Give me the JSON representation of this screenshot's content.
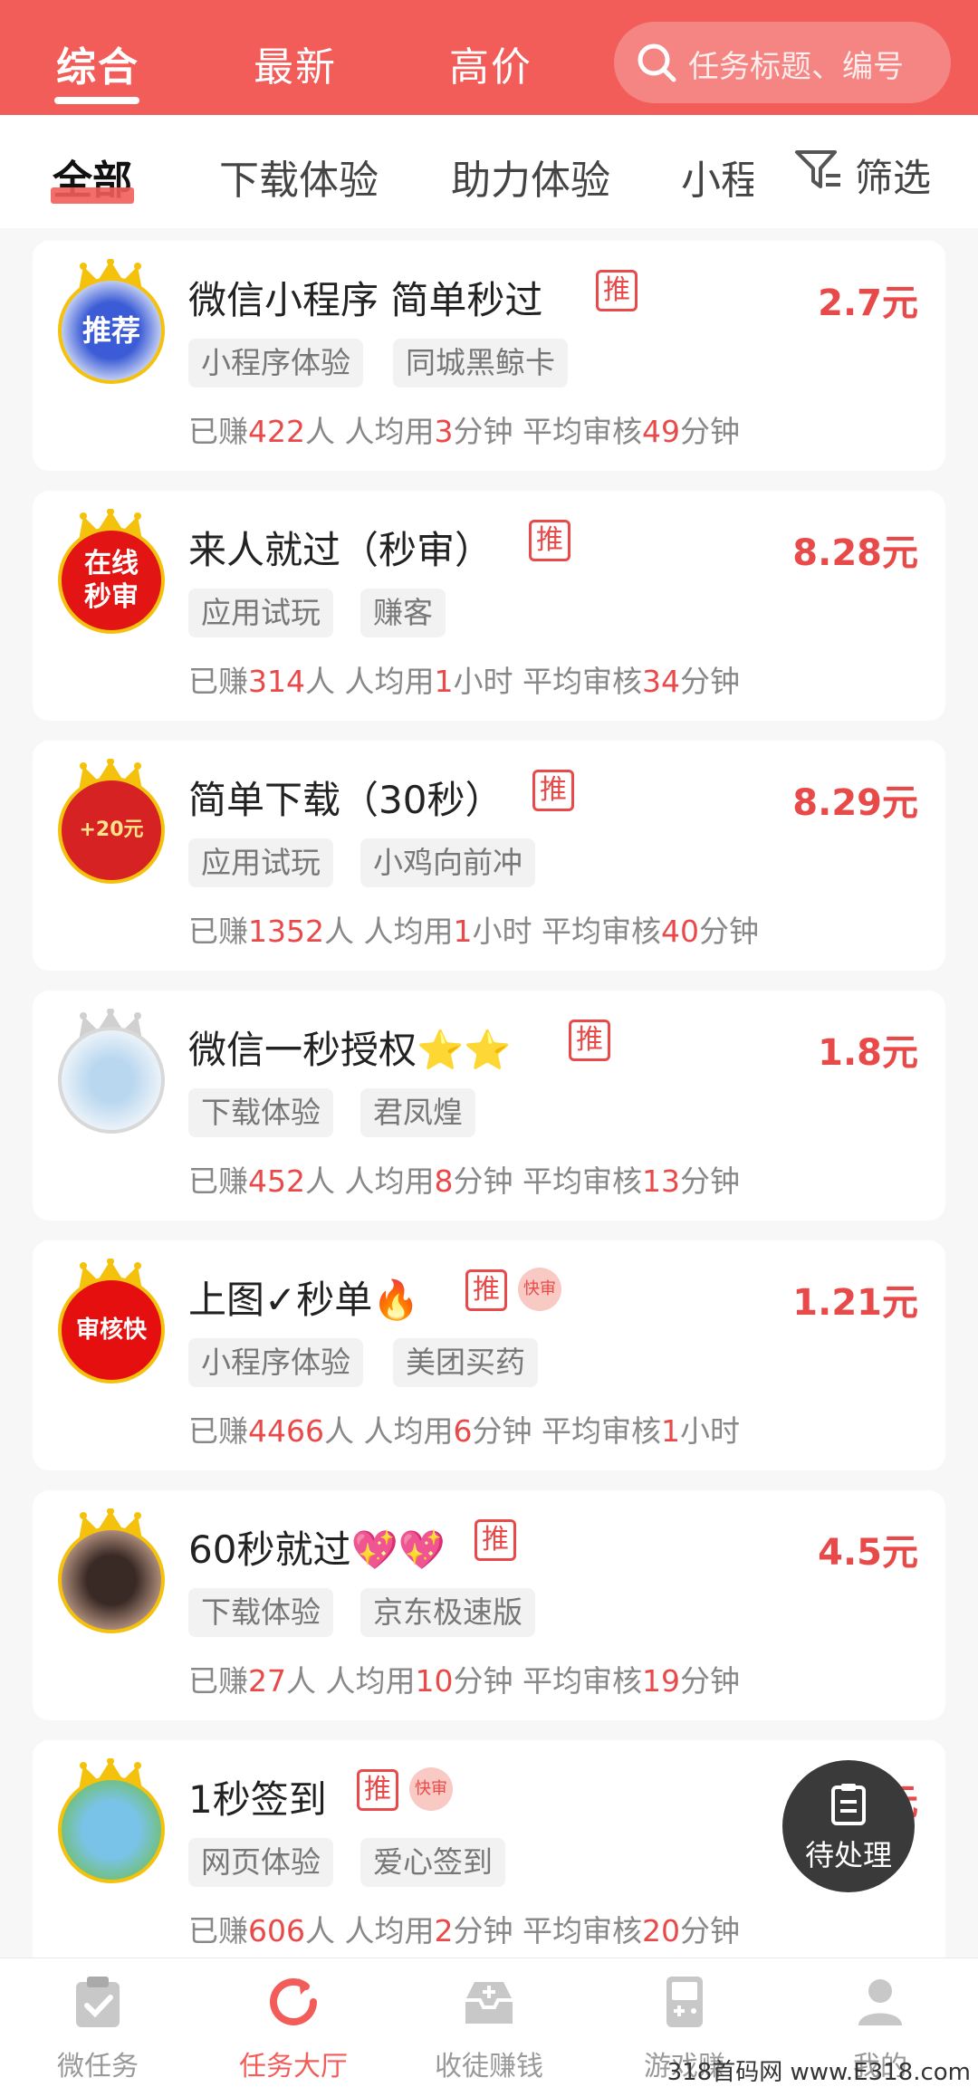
{
  "header": {
    "tabs": [
      {
        "label": "综合",
        "active": true
      },
      {
        "label": "最新",
        "active": false
      },
      {
        "label": "高价",
        "active": false
      }
    ],
    "search_placeholder": "任务标题、编号"
  },
  "subtabs": {
    "items": [
      "全部",
      "下载体验",
      "助力体验",
      "小程"
    ],
    "filter_label": "筛选"
  },
  "tasks": [
    {
      "title": "微信小程序 简单秒过",
      "price": "2.7元",
      "tags": [
        "小程序体验",
        "同城黑鲸卡"
      ],
      "earned": "422",
      "avg": "3",
      "avg_unit": "分钟",
      "review": "49",
      "review_unit": "分钟",
      "avatar_text": "推荐",
      "kuai": false
    },
    {
      "title": "来人就过（秒审）",
      "price": "8.28元",
      "tags": [
        "应用试玩",
        "赚客"
      ],
      "earned": "314",
      "avg": "1",
      "avg_unit": "小时",
      "review": "34",
      "review_unit": "分钟",
      "avatar_text": "在线秒审",
      "kuai": false
    },
    {
      "title": "简单下载（30秒）",
      "price": "8.29元",
      "tags": [
        "应用试玩",
        "小鸡向前冲"
      ],
      "earned": "1352",
      "avg": "1",
      "avg_unit": "小时",
      "review": "40",
      "review_unit": "分钟",
      "avatar_text": "+20元",
      "kuai": false
    },
    {
      "title": "微信一秒授权⭐⭐",
      "price": "1.8元",
      "tags": [
        "下载体验",
        "君凤煌"
      ],
      "earned": "452",
      "avg": "8",
      "avg_unit": "分钟",
      "review": "13",
      "review_unit": "分钟",
      "avatar_text": "",
      "kuai": false
    },
    {
      "title": "上图✓秒单🔥",
      "price": "1.21元",
      "tags": [
        "小程序体验",
        "美团买药"
      ],
      "earned": "4466",
      "avg": "6",
      "avg_unit": "分钟",
      "review": "1",
      "review_unit": "小时",
      "avatar_text": "审核快",
      "kuai": true
    },
    {
      "title": "60秒就过💖💖",
      "price": "4.5元",
      "tags": [
        "下载体验",
        "京东极速版"
      ],
      "earned": "27",
      "avg": "10",
      "avg_unit": "分钟",
      "review": "19",
      "review_unit": "分钟",
      "avatar_text": "",
      "kuai": false
    },
    {
      "title": "1秒签到",
      "price": "0.5元",
      "tags": [
        "网页体验",
        "爱心签到"
      ],
      "earned": "606",
      "avg": "2",
      "avg_unit": "分钟",
      "review": "20",
      "review_unit": "分钟",
      "avatar_text": "",
      "kuai": true
    }
  ],
  "labels": {
    "tui": "推",
    "kuai": "快审",
    "earned_prefix": "已赚",
    "earned_suffix": "人",
    "avg_prefix": "人均用",
    "review_prefix": "平均审核"
  },
  "fab_label": "待处理",
  "bottom_nav": [
    {
      "label": "微任务",
      "icon": "clipboard-check-icon",
      "active": false
    },
    {
      "label": "任务大厅",
      "icon": "refresh-icon",
      "active": true
    },
    {
      "label": "收徒赚钱",
      "icon": "inbox-plus-icon",
      "active": false
    },
    {
      "label": "游戏赚",
      "icon": "gameboy-icon",
      "active": false
    },
    {
      "label": "我的",
      "icon": "user-icon",
      "active": false
    }
  ],
  "watermark": "318首码网 www.E318.com",
  "colors": {
    "accent": "#f25d5a",
    "price": "#e84a4a"
  }
}
